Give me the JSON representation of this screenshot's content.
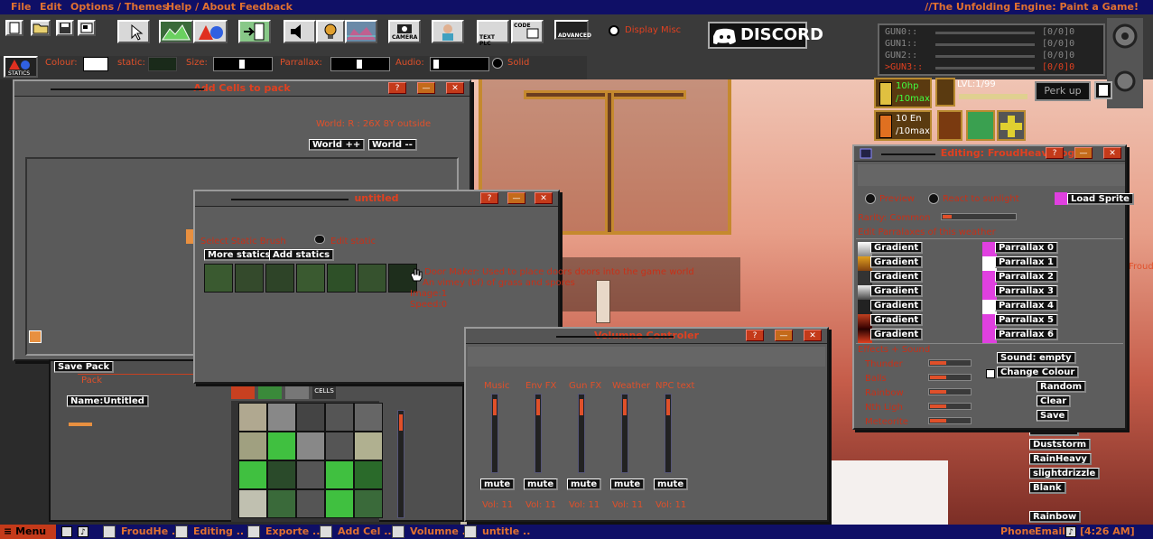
{
  "menubar": {
    "items": [
      "File",
      "Edit",
      "Options / Themes",
      "Help / About",
      "Feedback"
    ],
    "right_title": "//The Unfolding Engine: Paint a Game!"
  },
  "toolbar": {
    "display_misc": "Display Misc",
    "camera": "CAMERA",
    "text_plc": "TEXT PLC",
    "code": "CODE",
    "advanced": "ADVANCED",
    "discord": "DISCORD",
    "statics": "STATICS",
    "row2": {
      "colour": "Colour:",
      "static": "static:",
      "size": "Size:",
      "parrallax": "Parrallax:",
      "audio": "Audio:",
      "solid": "Solid"
    }
  },
  "hud": {
    "guns": [
      {
        "label": "GUN0::",
        "value": "[0/0]0"
      },
      {
        "label": "GUN1::",
        "value": "[0/0]0"
      },
      {
        "label": "GUN2::",
        "value": "[0/0]0"
      },
      {
        "label": ">GUN3::",
        "value": "[0/0]0"
      }
    ],
    "hp": "10hp",
    "hp_max": "/10max",
    "en": "10 En",
    "en_max": "/10max",
    "level": "LVL:1/99",
    "perk_up": "Perk up"
  },
  "win_addcells": {
    "title": "Add Cells to pack",
    "world_info": "World: R : 26X 8Y outside",
    "world_plus": "World ++",
    "world_minus": "World --",
    "save_pack": "Save Pack",
    "pack": "Pack",
    "name_untitled": "Name:Untitled",
    "cells": "CELLS"
  },
  "win_untitled": {
    "title": "untitled",
    "select_static_brush": "Select Static Brush",
    "edit_static": "Edit static",
    "more_statics": "More statics",
    "add_statics": "Add statics",
    "desc_line1": "Door Maker: Used to place doors doors into the game world",
    "desc_line2": "An vimey (bf) of grass and spores",
    "desc_line3": "Image:1",
    "desc_line4": "Speed:0"
  },
  "win_volume": {
    "title": "Volumne Controler",
    "channels": [
      {
        "label": "Music",
        "mute": "mute",
        "vol": "Vol: 11"
      },
      {
        "label": "Env FX",
        "mute": "mute",
        "vol": "Vol: 11"
      },
      {
        "label": "Gun FX",
        "mute": "mute",
        "vol": "Vol: 11"
      },
      {
        "label": "Weather",
        "mute": "mute",
        "vol": "Vol: 11"
      },
      {
        "label": "NPC text",
        "mute": "mute",
        "vol": "Vol: 11"
      }
    ]
  },
  "win_editing": {
    "title": "Editing: FroudHeavyFog",
    "preview": "Preview",
    "react_to_sunlight": "React to sunlight",
    "load_sprite": "Load Sprite",
    "rarity": "Rarity: Common",
    "edit_parallaxes": "Edit Parralaxes of this weather",
    "gradients": [
      "Gradient",
      "Gradient",
      "Gradient",
      "Gradient",
      "Gradient",
      "Gradient",
      "Gradient"
    ],
    "parallaxes": [
      "Parrallax 0",
      "Parrallax 1",
      "Parrallax 2",
      "Parrallax 3",
      "Parrallax 4",
      "Parrallax 5",
      "Parrallax 6"
    ],
    "effects_sound": "Effects + Sound",
    "effects": [
      "Thunder",
      "Balls",
      "Rainbow",
      "Nth Ligh",
      "Meteorite"
    ],
    "sound_empty": "Sound: empty",
    "change_colour": "Change Colour",
    "random": "Random",
    "clear": "Clear",
    "save": "Save"
  },
  "weather_list": [
    "Emerald",
    "Duststorm",
    "RainHeavy",
    "slightdrizzle",
    "Blank",
    "Rainbow"
  ],
  "offscreen_label": "FroudFo",
  "taskbar": {
    "menu": "Menu",
    "tasks": [
      "FroudHe ..",
      "Editing ..",
      "Exporte ..",
      "Add Cel ..",
      "Volumne ..",
      "untitle .."
    ],
    "phone": "Phone",
    "email": "Email",
    "clock": "[4:26 AM]"
  },
  "colors": {
    "accent": "#e0502a",
    "menubar_bg": "#0f0f66",
    "window_bg": "#5d5d5d"
  }
}
